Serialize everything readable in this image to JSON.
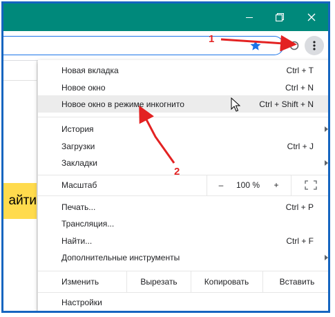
{
  "colors": {
    "titlebar": "#00897b",
    "border": "#1565c0",
    "arrow": "#e32222",
    "highlight": "#ececec",
    "search_button": "#ffdb4d"
  },
  "page": {
    "search_button_fragment": "айти"
  },
  "menu": {
    "items": [
      {
        "id": "new_tab",
        "label": "Новая вкладка",
        "shortcut": "Ctrl + T"
      },
      {
        "id": "new_window",
        "label": "Новое окно",
        "shortcut": "Ctrl + N"
      },
      {
        "id": "incognito",
        "label": "Новое окно в режиме инкогнито",
        "shortcut": "Ctrl + Shift + N"
      },
      {
        "id": "history",
        "label": "История",
        "shortcut": ""
      },
      {
        "id": "downloads",
        "label": "Загрузки",
        "shortcut": "Ctrl + J"
      },
      {
        "id": "bookmarks",
        "label": "Закладки",
        "shortcut": ""
      },
      {
        "id": "print",
        "label": "Печать...",
        "shortcut": "Ctrl + P"
      },
      {
        "id": "cast",
        "label": "Трансляция...",
        "shortcut": ""
      },
      {
        "id": "find",
        "label": "Найти...",
        "shortcut": "Ctrl + F"
      },
      {
        "id": "more_tools",
        "label": "Дополнительные инструменты",
        "shortcut": ""
      },
      {
        "id": "settings",
        "label": "Настройки",
        "shortcut": ""
      }
    ],
    "zoom": {
      "label": "Масштаб",
      "minus": "–",
      "value": "100 %",
      "plus": "+"
    },
    "edit": {
      "label": "Изменить",
      "cut": "Вырезать",
      "copy": "Копировать",
      "paste": "Вставить"
    }
  },
  "annotations": {
    "step1": "1",
    "step2": "2"
  }
}
